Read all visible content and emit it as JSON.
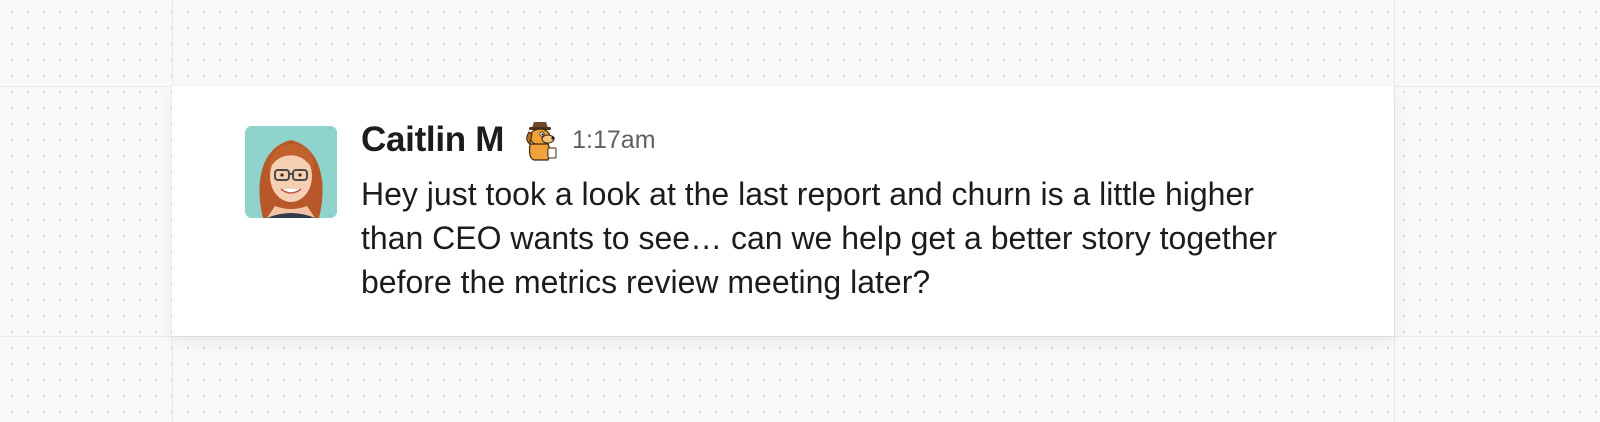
{
  "message": {
    "sender": "Caitlin M",
    "status_emoji": "this-is-fine-dog-icon",
    "timestamp": "1:17am",
    "text": "Hey just took a look at the last report and churn is a little higher than CEO wants to see… can we help get a better story together before the metrics review meeting later?"
  },
  "colors": {
    "background": "#f8f7f9",
    "card": "#ffffff",
    "text_primary": "#1d1c1d",
    "text_secondary": "#616061",
    "avatar_bg": "#8fd3cc"
  }
}
